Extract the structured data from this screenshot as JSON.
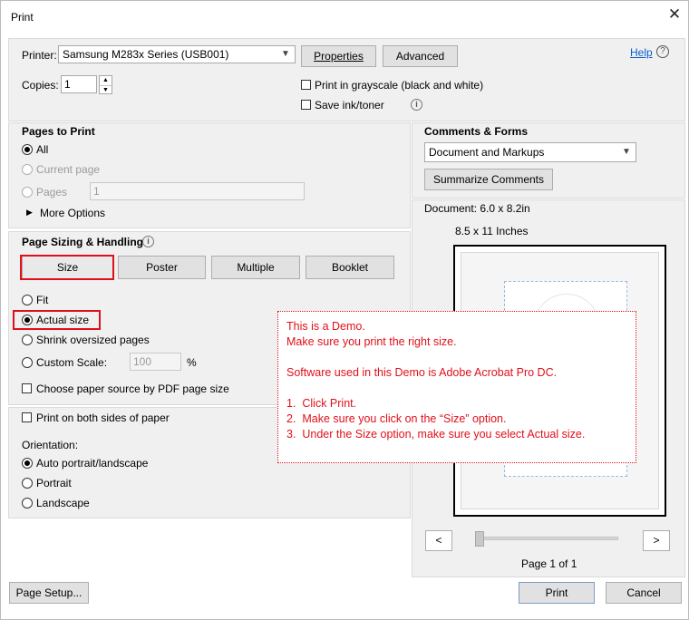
{
  "window": {
    "title": "Print"
  },
  "header": {
    "printer_label": "Printer:",
    "printer_value": "Samsung M283x Series (USB001)",
    "properties_label": "Properties",
    "advanced_label": "Advanced",
    "help_label": "Help",
    "copies_label": "Copies:",
    "copies_value": "1",
    "grayscale_label": "Print in grayscale (black and white)",
    "save_ink_label": "Save ink/toner"
  },
  "pages_to_print": {
    "title": "Pages to Print",
    "all_label": "All",
    "current_page_label": "Current page",
    "pages_label": "Pages",
    "pages_value": "1",
    "more_options_label": "More Options"
  },
  "page_sizing": {
    "title": "Page Sizing & Handling",
    "tabs": [
      "Size",
      "Poster",
      "Multiple",
      "Booklet"
    ],
    "fit_label": "Fit",
    "actual_size_label": "Actual size",
    "shrink_label": "Shrink oversized pages",
    "custom_scale_label": "Custom Scale:",
    "custom_scale_value": "100",
    "percent_label": "%",
    "paper_source_label": "Choose paper source by PDF page size"
  },
  "both_sides": {
    "label": "Print on both sides of paper"
  },
  "orientation": {
    "title": "Orientation:",
    "auto_label": "Auto portrait/landscape",
    "portrait_label": "Portrait",
    "landscape_label": "Landscape"
  },
  "comments_forms": {
    "title": "Comments & Forms",
    "value": "Document and Markups",
    "summarize_label": "Summarize Comments"
  },
  "preview": {
    "document_label": "Document: 6.0 x 8.2in",
    "paper_label": "8.5 x 11 Inches",
    "prev_label": "<",
    "next_label": ">",
    "page_label": "Page 1 of 1"
  },
  "footer": {
    "page_setup_label": "Page Setup...",
    "print_label": "Print",
    "cancel_label": "Cancel"
  },
  "demo_note": {
    "line1": "This is a Demo.",
    "line2": "Make sure you print the right size.",
    "line3": "Software used in this Demo is Adobe Acrobat Pro DC.",
    "step1": "1.  Click Print.",
    "step2": "2.  Make sure you click on the “Size” option.",
    "step3": "3.  Under the Size option, make sure you select Actual size."
  },
  "colors": {
    "highlight": "#e0101a",
    "link": "#0b5ec9",
    "panel": "#f0f0f0"
  }
}
